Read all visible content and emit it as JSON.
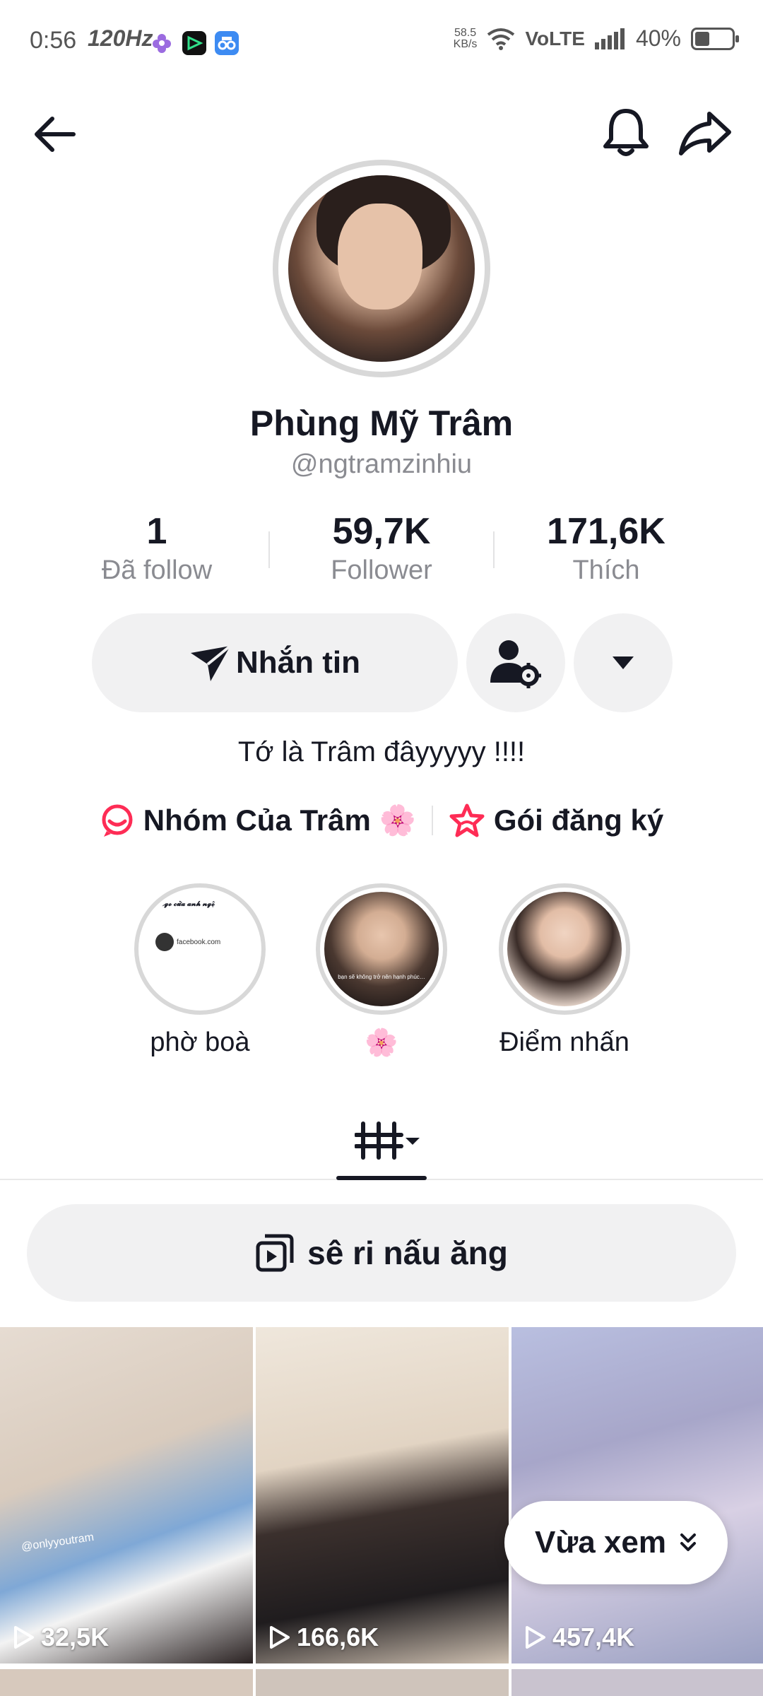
{
  "status_bar": {
    "time": "0:56",
    "refresh": "120Hz",
    "net_speed_value": "58.5",
    "net_speed_unit": "KB/s",
    "network": "VoLTE",
    "battery": "40%",
    "battery_level": 0.4
  },
  "nav": {
    "back_icon": "arrow-left-icon",
    "bell_icon": "bell-icon",
    "share_icon": "share-icon"
  },
  "profile": {
    "name": "Phùng Mỹ Trâm",
    "handle": "@ngtramzinhiu",
    "bio": "Tớ là Trâm đâyyyyy !!!!"
  },
  "stats": [
    {
      "value": "1",
      "label": "Đã follow"
    },
    {
      "value": "59,7K",
      "label": "Follower"
    },
    {
      "value": "171,6K",
      "label": "Thích"
    }
  ],
  "actions": {
    "message": "Nhắn tin"
  },
  "links": {
    "group": "Nhóm Của Trâm 🌸",
    "subscription": "Gói đăng ký"
  },
  "highlights": [
    {
      "label": "phờ boà",
      "thumb_title": "𝔂𝓮𝓰𝓸 𝓬𝓾̛̉𝓪 𝓪𝓷𝓱 𝓷𝓰𝓸̣̂",
      "thumb_text": "facebook.com"
    },
    {
      "label": "🌸",
      "thumb_caption": "bạn sẽ không trở nên hạnh phúc…"
    },
    {
      "label": "Điểm nhấn"
    }
  ],
  "playlist": {
    "label": "sê ri nấu ăng"
  },
  "videos": [
    {
      "views": "32,5K",
      "watermark": "@onlyyoutram"
    },
    {
      "views": "166,6K"
    },
    {
      "views": "457,4K"
    }
  ],
  "recent_button": {
    "label": "Vừa xem"
  },
  "colors": {
    "text": "#161823",
    "muted": "#8a8b91",
    "chip_bg": "#f1f1f2",
    "accent": "#fe2c55"
  }
}
